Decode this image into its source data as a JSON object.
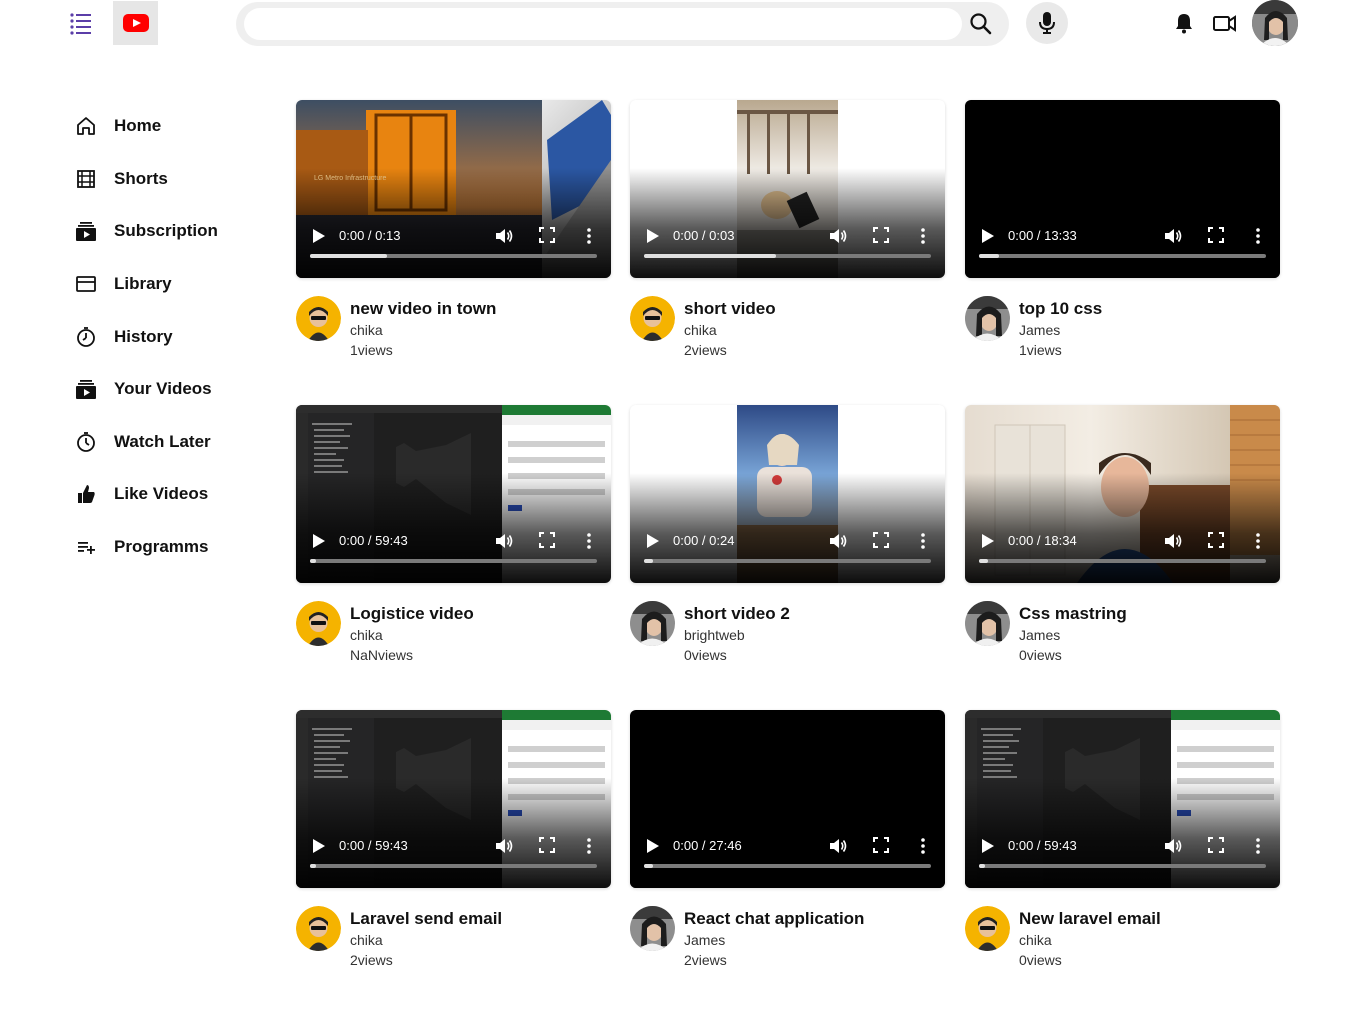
{
  "header": {
    "search_placeholder": "",
    "search_value": ""
  },
  "sidebar": {
    "items": [
      {
        "label": "Home",
        "icon": "home-icon"
      },
      {
        "label": "Shorts",
        "icon": "shorts-icon"
      },
      {
        "label": "Subscription",
        "icon": "subscription-icon"
      },
      {
        "label": "Library",
        "icon": "library-icon"
      },
      {
        "label": "History",
        "icon": "history-icon"
      },
      {
        "label": "Your Videos",
        "icon": "your-videos-icon"
      },
      {
        "label": "Watch Later",
        "icon": "watch-later-icon"
      },
      {
        "label": "Like Videos",
        "icon": "like-icon"
      },
      {
        "label": "Programms",
        "icon": "playlist-add-icon"
      }
    ]
  },
  "colors": {
    "accent_purple": "#5b3ea8",
    "logo_red": "#ff0000",
    "avatar_yellow": "#f5b300"
  },
  "videos": [
    {
      "title": "new video in town",
      "channel": "chika",
      "views": "1views",
      "time": "0:00 / 0:13",
      "progress": 0.27,
      "thumb": "truck",
      "avatar": "cartoon"
    },
    {
      "title": "short video",
      "channel": "chika",
      "views": "2views",
      "time": "0:00 / 0:03",
      "progress": 0.46,
      "thumb": "bed",
      "avatar": "cartoon"
    },
    {
      "title": "top 10 css",
      "channel": "James",
      "views": "1views",
      "time": "0:00 / 13:33",
      "progress": 0.07,
      "thumb": "black",
      "avatar": "photo"
    },
    {
      "title": "Logistice video",
      "channel": "chika",
      "views": "NaNviews",
      "time": "0:00 / 59:43",
      "progress": 0.02,
      "thumb": "code",
      "avatar": "cartoon"
    },
    {
      "title": "short video 2",
      "channel": "brightweb",
      "views": "0views",
      "time": "0:00 / 0:24",
      "progress": 0.03,
      "thumb": "girl",
      "avatar": "photo"
    },
    {
      "title": "Css mastring",
      "channel": "James",
      "views": "0views",
      "time": "0:00 / 18:34",
      "progress": 0.03,
      "thumb": "man",
      "avatar": "photo"
    },
    {
      "title": "Laravel send email",
      "channel": "chika",
      "views": "2views",
      "time": "0:00 / 59:43",
      "progress": 0.02,
      "thumb": "code",
      "avatar": "cartoon"
    },
    {
      "title": "React chat application",
      "channel": "James",
      "views": "2views",
      "time": "0:00 / 27:46",
      "progress": 0.03,
      "thumb": "black",
      "avatar": "photo"
    },
    {
      "title": "New laravel email",
      "channel": "chika",
      "views": "0views",
      "time": "0:00 / 59:43",
      "progress": 0.02,
      "thumb": "code",
      "avatar": "cartoon"
    }
  ]
}
